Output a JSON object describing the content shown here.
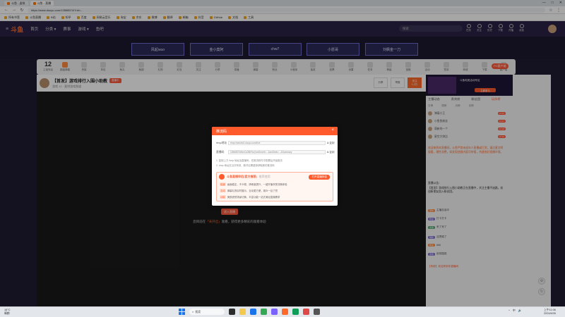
{
  "browser": {
    "tabs": [
      {
        "label": "斗鱼 - 虚拟",
        "active": false
      },
      {
        "label": "斗鱼 - 直播",
        "active": true
      }
    ],
    "url": "https://www.douyu.com/13568574/?rid=...",
    "window_controls": [
      "—",
      "□",
      "✕"
    ],
    "bookmarks": [
      "所有书签",
      "斗鱼直播",
      "B站",
      "知乎",
      "百度",
      "网易云音乐",
      "淘宝",
      "京东",
      "微博",
      "翻译",
      "邮箱",
      "抖音",
      "GitHub",
      "文档",
      "工具"
    ]
  },
  "site": {
    "logo": "斗鱼",
    "nav": [
      "首页",
      "分类 ▾",
      "赛事",
      "游戏 ▾",
      "鱼吧"
    ],
    "search_placeholder": "搜索",
    "header_icons": [
      "任务",
      "关注",
      "历史",
      "下载",
      "开播",
      "消息"
    ]
  },
  "recommend": [
    "风起wuo",
    "金小莫阿",
    "chw7",
    "小愿哥",
    "刘枫金一刀"
  ],
  "funcbar": {
    "count": "12",
    "count_label": "主播等级",
    "items": [
      "超级弹幕",
      "贵族",
      "背包",
      "鱼丸",
      "鱼翅",
      "礼物",
      "红包",
      "关注",
      "分享",
      "录播",
      "弹幕",
      "粉丝",
      "小程序",
      "抽奖",
      "投票",
      "设置",
      "任务",
      "等级",
      "宝箱",
      "活动",
      "签到",
      "商城",
      "下载",
      "客户端",
      "投稿",
      "更多"
    ],
    "pc_badge": "PC客户端"
  },
  "room": {
    "title": "【首发】游戏排行入围小助教",
    "tag": "直播中",
    "sub": "游戏 12 · 星饼游戏频道",
    "buttons": [
      "分享",
      "举报",
      "关注"
    ],
    "follow_count": "1.2万"
  },
  "player": {
    "enter_label": "进入直播",
    "hint_prefix": "您目前在",
    "hint_link": "「未开启」",
    "hint_suffix": "观看，获得更多精彩的观看体验"
  },
  "modal": {
    "title": "推流码",
    "close": "×",
    "rows": [
      {
        "label": "rtmp地址",
        "value": "rtmp://sendtc3.douyu.com/live",
        "copy": "复制"
      },
      {
        "label": "直播码",
        "value": "13568574rBmCa3BrFkq?wsSecret=...&wsSeek=...&Summary",
        "copy": "复制"
      }
    ],
    "notes": [
      "1. 复制上方 rtmp 地址及直播码，在推流软件中配置后开始推流",
      "2. rtmp 地址仅当次有效，断开后需重新获取新的推流码"
    ],
    "promo": {
      "title": "斗鱼直播伴侣(官方推荐)",
      "subtitle": "推荐使用",
      "button": "打开直播伴侣",
      "lines": [
        {
          "tag": "极速",
          "text": "画面稳定，不卡顿，清晰度提升，一键开播享受流畅体验"
        },
        {
          "tag": "互动",
          "text": "弹幕礼物实时展示，互动更方便，观众一目了然"
        },
        {
          "tag": "功能",
          "text": "美颜滤镜场景切换，丰富功能一站式满足直播需求"
        }
      ]
    }
  },
  "sidebar": {
    "ad_text": "斗鱼电竞活动专区",
    "ad_button": "立即参与",
    "tabs": [
      "主播动态",
      "贵宾席",
      "粉丝团",
      "玩伴榜"
    ],
    "active_tab": "玩伴榜",
    "subtabs": [
      "日榜",
      "周榜",
      "月榜",
      "总榜"
    ],
    "ranks": [
      {
        "name": "弹幕小王",
        "lv": "LV.33"
      },
      {
        "name": "小鱼鱼粉丝",
        "lv": "LV.21"
      },
      {
        "name": "萌新的一个",
        "lv": "LV.18"
      },
      {
        "name": "星空大帅比",
        "lv": "LV.16"
      }
    ],
    "notice": "欢迎来到本直播间，斗鱼严禁未成年人直播或打赏，请注意文明观看，理性消费，如发现违规内容可举报，共建良好直播环境。",
    "system": "直播公告：",
    "system_msg": "【首发】游戏排行入围小助教正在直播中，关注主播不迷路，欢迎新朋友加入粉丝团。",
    "chats": [
      {
        "badge": "萌新",
        "text": "主播加油冲",
        "variant": "or"
      },
      {
        "badge": "粉丝",
        "text": "打卡打卡",
        "variant": ""
      },
      {
        "badge": "贵族",
        "text": "来了来了",
        "variant": "gr"
      },
      {
        "badge": "萌新",
        "text": "这把稳了",
        "variant": ""
      },
      {
        "badge": "粉丝",
        "text": "666",
        "variant": "or"
      },
      {
        "badge": "贵族",
        "text": "前排围观",
        "variant": ""
      }
    ],
    "footer": "【系统】欢迎来到本直播间"
  },
  "taskbar": {
    "weather_temp": "16°C",
    "weather_text": "晴朗",
    "search": "搜索",
    "time": "上午11:06",
    "date": "2024/6/26",
    "tray": [
      "^",
      "中",
      "🔊"
    ]
  }
}
